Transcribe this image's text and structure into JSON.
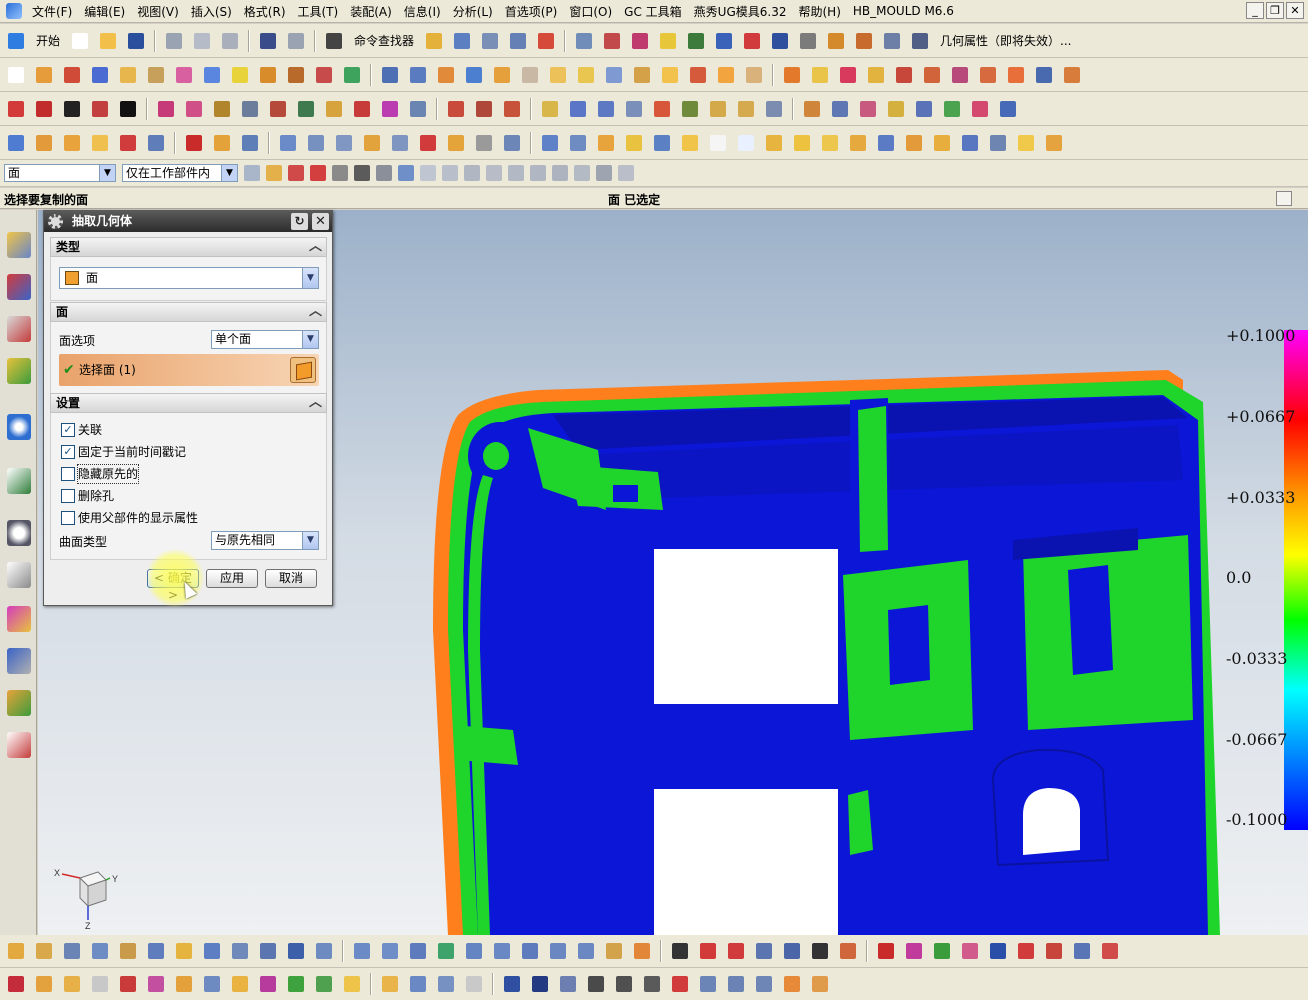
{
  "menubar": {
    "items": [
      "文件(F)",
      "编辑(E)",
      "视图(V)",
      "插入(S)",
      "格式(R)",
      "工具(T)",
      "装配(A)",
      "信息(I)",
      "分析(L)",
      "首选项(P)",
      "窗口(O)",
      "GC 工具箱",
      "燕秀UG模具6.32",
      "帮助(H)",
      "HB_MOULD M6.6"
    ]
  },
  "toolbar1": {
    "start_label": "开始",
    "command_finder_label": "命令查找器",
    "geometry_props_label": "几何属性（即将失效）..."
  },
  "filterbar": {
    "type_filter": "面",
    "scope_filter": "仅在工作部件内"
  },
  "status": {
    "prompt": "选择要复制的面",
    "message": "面 已选定"
  },
  "dialog": {
    "title": "抽取几何体",
    "type_section": "类型",
    "type_value": "面",
    "face_section": "面",
    "face_option_label": "面选项",
    "face_option_value": "单个面",
    "select_face_label": "选择面 (1)",
    "settings_section": "设置",
    "checkboxes": [
      {
        "label": "关联",
        "checked": true
      },
      {
        "label": "固定于当前时间戳记",
        "checked": true
      },
      {
        "label": "隐藏原先的",
        "checked": false
      },
      {
        "label": "删除孔",
        "checked": false
      },
      {
        "label": "使用父部件的显示属性",
        "checked": false
      }
    ],
    "surface_type_label": "曲面类型",
    "surface_type_value": "与原先相同",
    "ok_label": "< 确定 >",
    "apply_label": "应用",
    "cancel_label": "取消"
  },
  "legend": {
    "labels": [
      "+0.1000",
      "+0.0667",
      "+0.0333",
      "0.0",
      "-0.0333",
      "-0.0667",
      "-0.1000"
    ]
  },
  "triad": {
    "x": "X",
    "y": "Y",
    "z": "Z"
  },
  "colors": {
    "part_body": "#0c16d6",
    "part_walls": "#1fd42a",
    "selected_face": "#ff7f1c",
    "dialog_title": "#3a3a3a"
  }
}
